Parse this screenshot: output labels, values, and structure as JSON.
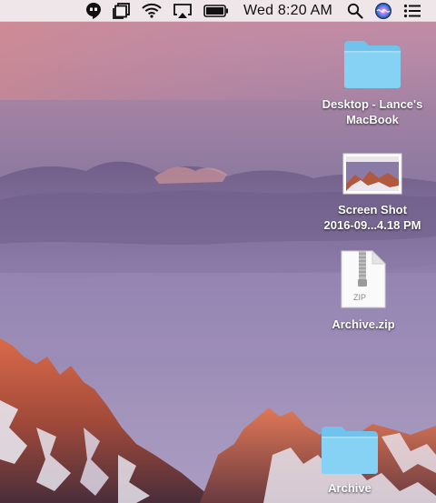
{
  "menubar": {
    "clock": "Wed 8:20 AM",
    "icons": [
      "hangouts-icon",
      "clipboard-stack-icon",
      "wifi-icon",
      "airplay-icon",
      "battery-icon",
      "spotlight-search-icon",
      "siri-icon",
      "notification-center-icon"
    ]
  },
  "desktop": {
    "icons": [
      {
        "kind": "folder",
        "label_line1": "Desktop - Lance's",
        "label_line2": "MacBook"
      },
      {
        "kind": "screenshot",
        "label_line1": "Screen Shot",
        "label_line2": "2016-09...4.18 PM"
      },
      {
        "kind": "zip",
        "label_line1": "Archive.zip",
        "badge": "ZIP"
      },
      {
        "kind": "folder",
        "label_line1": "Archive"
      }
    ]
  },
  "colors": {
    "folder": "#7fcdf0",
    "folder_tab": "#9bd9f4",
    "menubar": "#f2eef0",
    "label_text": "#ffffff"
  }
}
